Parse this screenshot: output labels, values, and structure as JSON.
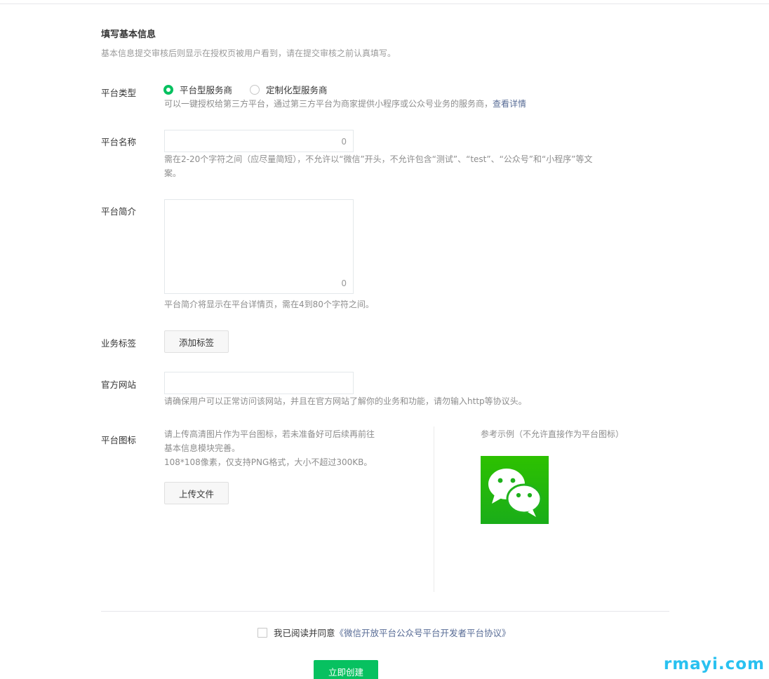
{
  "section": {
    "title": "填写基本信息",
    "description": "基本信息提交审核后则显示在授权页被用户看到，请在提交审核之前认真填写。"
  },
  "platform_type": {
    "label": "平台类型",
    "options": [
      "平台型服务商",
      "定制化型服务商"
    ],
    "selected": "平台型服务商",
    "tip": "可以一键授权给第三方平台，通过第三方平台为商家提供小程序或公众号业务的服务商，",
    "tip_link": "查看详情"
  },
  "platform_name": {
    "label": "平台名称",
    "value": "",
    "counter": "0",
    "tip_line1": "需在2-20个字符之间（应尽量简短），不允许以“微信”开头，不允许包含“测试”、“test”、“公众号”和“小程序”等文",
    "tip_line2": "案。"
  },
  "platform_intro": {
    "label": "平台简介",
    "value": "",
    "counter": "0",
    "tip": "平台简介将显示在平台详情页，需在4到80个字符之间。"
  },
  "business_tags": {
    "label": "业务标签",
    "button": "添加标签"
  },
  "website": {
    "label": "官方网站",
    "value": "",
    "tip": "请确保用户可以正常访问该网站，并且在官方网站了解你的业务和功能，请勿输入http等协议头。"
  },
  "platform_icon": {
    "label": "平台图标",
    "tip_line1": "请上传高清图片作为平台图标，若未准备好可后续再前往",
    "tip_line2": "基本信息模块完善。",
    "tip_line3": "108*108像素，仅支持PNG格式，大小不超过300KB。",
    "upload_button": "上传文件",
    "example_title": "参考示例（不允许直接作为平台图标）",
    "example_icon": "wechat-logo"
  },
  "agreement": {
    "checked": false,
    "text": "我已阅读并同意",
    "link": "《微信开放平台公众号平台开发者平台协议》"
  },
  "submit": {
    "label": "立即创建"
  },
  "watermark": "rmayi.com",
  "colors": {
    "accent": "#07c160",
    "link": "#576b95",
    "watermark": "#29c1f0"
  }
}
